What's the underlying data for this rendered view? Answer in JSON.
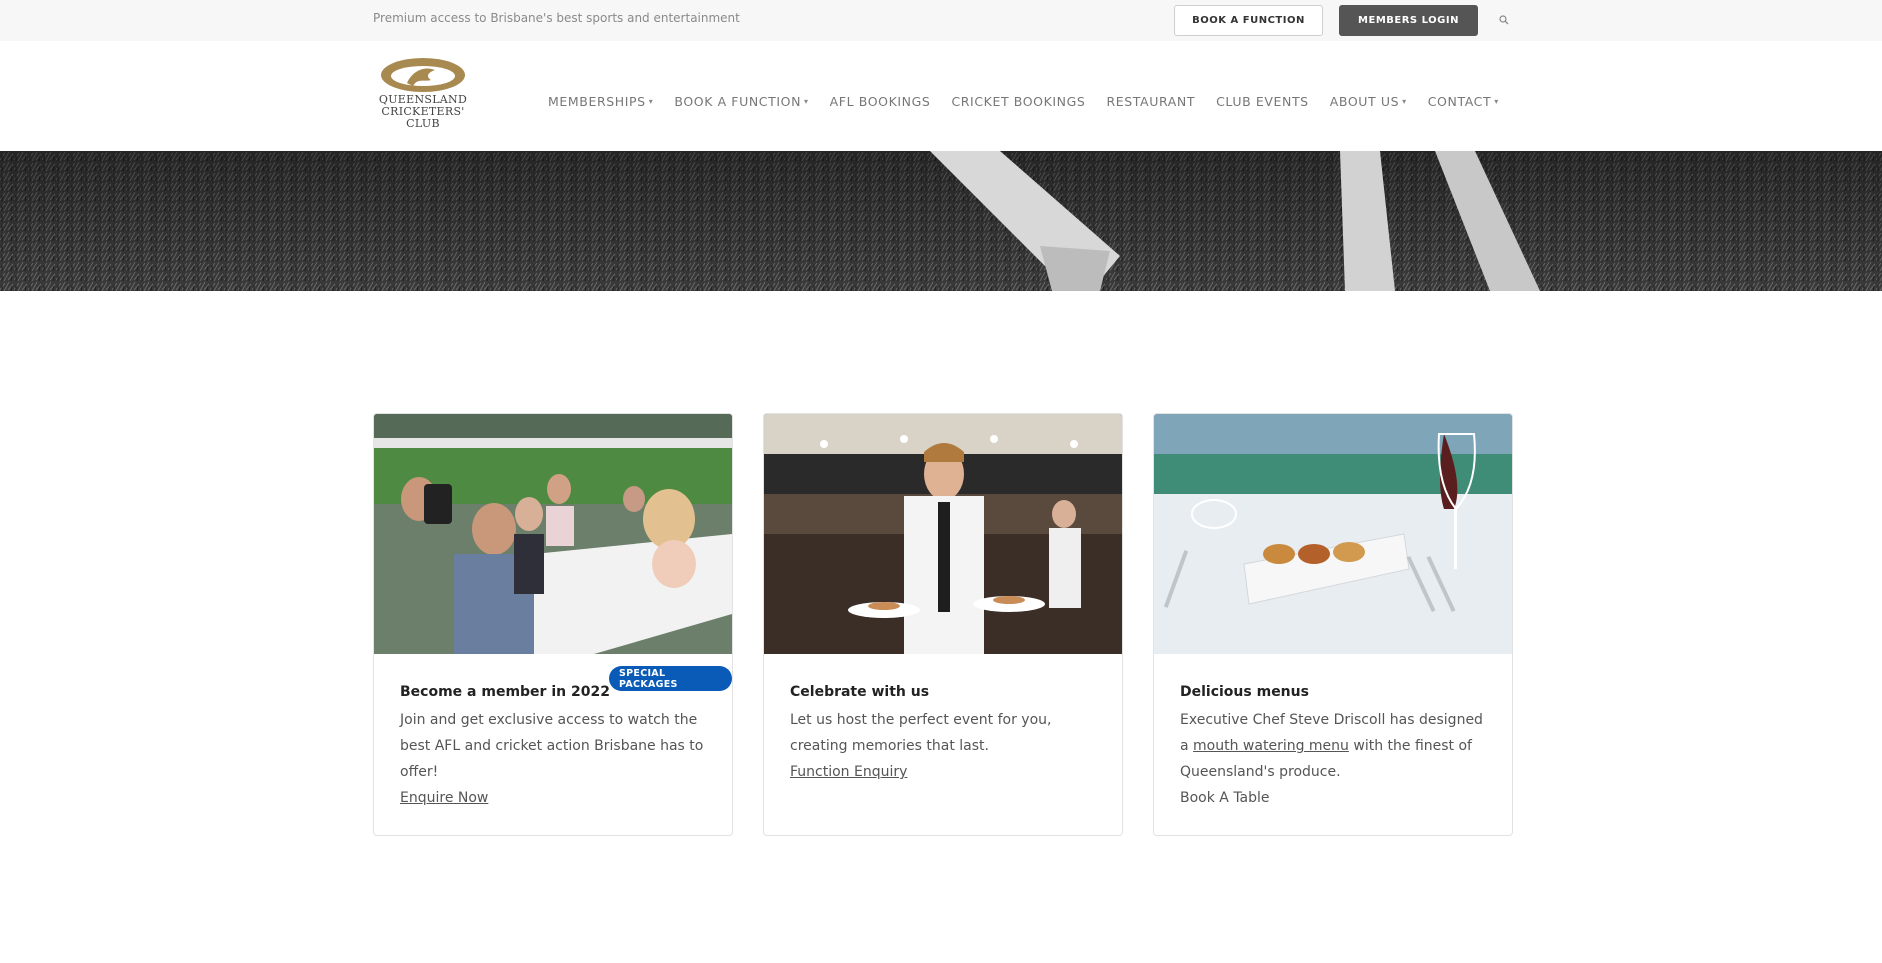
{
  "topbar": {
    "tagline": "Premium access to Brisbane's best sports and entertainment",
    "book_function_label": "BOOK A FUNCTION",
    "members_login_label": "MEMBERS LOGIN",
    "search_icon": "search-icon"
  },
  "logo": {
    "text_line1": "QUEENSLAND",
    "text_line2": "CRICKETERS'",
    "text_line3": "CLUB",
    "color": "#a8894f"
  },
  "nav": {
    "items": [
      {
        "label": "MEMBERSHIPS",
        "dropdown": true
      },
      {
        "label": "BOOK A FUNCTION",
        "dropdown": true
      },
      {
        "label": "AFL BOOKINGS",
        "dropdown": false
      },
      {
        "label": "CRICKET BOOKINGS",
        "dropdown": false
      },
      {
        "label": "RESTAURANT",
        "dropdown": false
      },
      {
        "label": "CLUB EVENTS",
        "dropdown": false
      },
      {
        "label": "ABOUT US",
        "dropdown": true
      },
      {
        "label": "CONTACT",
        "dropdown": true
      }
    ]
  },
  "cards": [
    {
      "title": "Become a member in 2022",
      "text": "Join and get exclusive access to watch the best AFL and cricket action Brisbane has to offer!",
      "link": "Enquire Now",
      "badge": "SPECIAL PACKAGES"
    },
    {
      "title": "Celebrate with us",
      "text": "Let us host the perfect event for you, creating memories that last.",
      "link": "Function Enquiry"
    },
    {
      "title": "Delicious menus",
      "text_before": "Executive Chef Steve Driscoll has designed a",
      "link": "mouth watering menu",
      "text_after": "with the finest of Queensland's produce.",
      "extra": "Book A Table"
    }
  ],
  "colors": {
    "badge": "#0a5bb8",
    "login_button": "#555555"
  }
}
